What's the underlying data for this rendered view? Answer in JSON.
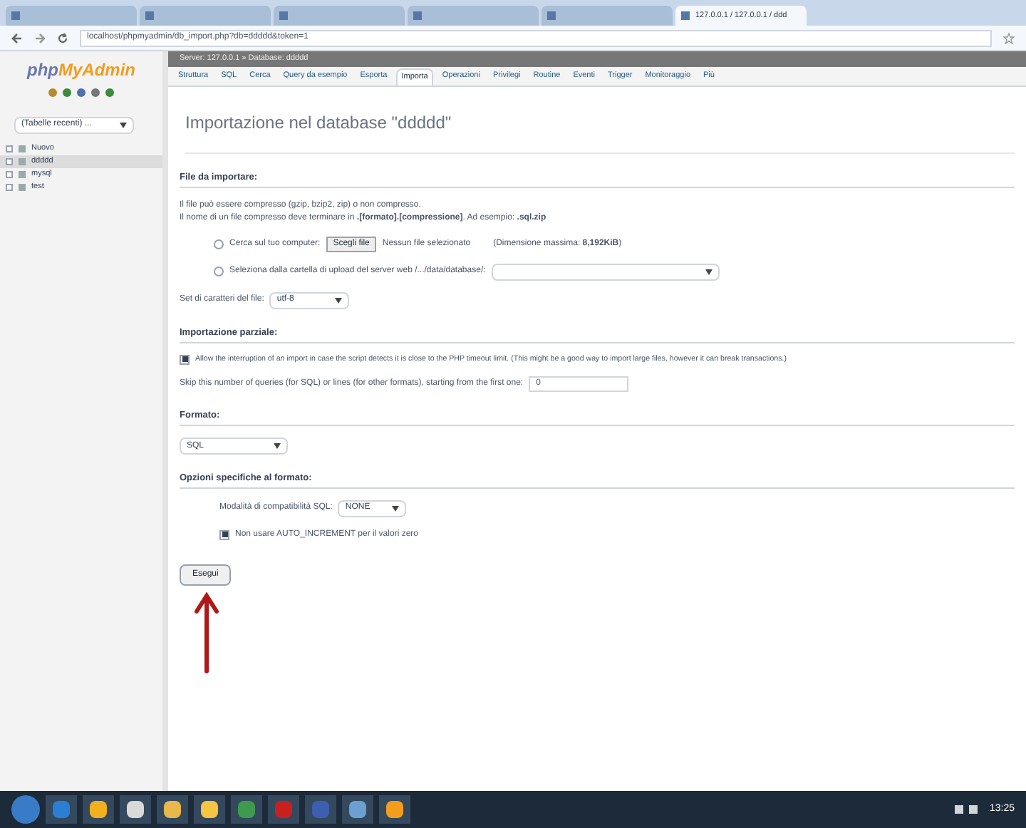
{
  "browser": {
    "tabs": [
      {
        "selected": false
      },
      {
        "selected": false
      },
      {
        "selected": false
      },
      {
        "selected": false
      },
      {
        "selected": false
      },
      {
        "title": "127.0.0.1 / 127.0.0.1 / ddd",
        "selected": true
      }
    ],
    "url": "localhost/phpmyadmin/db_import.php?db=ddddd&token=1"
  },
  "sidebar": {
    "logo_php": "php",
    "logo_name": "MyAdmin",
    "recent": "(Tabelle recenti) ...",
    "tree": [
      {
        "label": "Nuovo",
        "selected": false
      },
      {
        "label": "ddddd",
        "selected": true
      },
      {
        "label": "mysql",
        "selected": false
      },
      {
        "label": "test",
        "selected": false
      }
    ]
  },
  "breadcrumb": "Server: 127.0.0.1 » Database: ddddd",
  "tabs": [
    {
      "label": "Struttura",
      "selected": false
    },
    {
      "label": "SQL",
      "selected": false
    },
    {
      "label": "Cerca",
      "selected": false
    },
    {
      "label": "Query da esempio",
      "selected": false
    },
    {
      "label": "Esporta",
      "selected": false
    },
    {
      "label": "Importa",
      "selected": true
    },
    {
      "label": "Operazioni",
      "selected": false
    },
    {
      "label": "Privilegi",
      "selected": false
    },
    {
      "label": "Routine",
      "selected": false
    },
    {
      "label": "Eventi",
      "selected": false
    },
    {
      "label": "Trigger",
      "selected": false
    },
    {
      "label": "Monitoraggio",
      "selected": false
    },
    {
      "label": "Più",
      "selected": false
    }
  ],
  "title": "Importazione nel database \"ddddd\"",
  "file_section": {
    "heading": "File da importare:",
    "note_1": "Il file può essere compresso (gzip, bzip2, zip) o non compresso.",
    "note_2": "Il nome di un file compresso deve terminare in **.[formato].[compressione]**. Ad esempio: **.sql.zip**",
    "browse": {
      "label": "Cerca sul tuo computer:",
      "selected": false,
      "button": "Scegli file",
      "status": "Nessun file selezionato",
      "max": "(Dimensione massima: **8,192KiB**)"
    },
    "server": {
      "label": "Seleziona dalla cartella di upload del server web /.../data/database/:",
      "selected": false
    },
    "charset_label": "Set di caratteri del file:",
    "charset": "utf-8"
  },
  "partial": {
    "heading": "Importazione parziale:",
    "allow": {
      "label": "Allow the interruption of an import in case the script detects it is close to the PHP timeout limit. (This might be a good way to import large files, however it can break transactions.)",
      "checked": true
    },
    "skip_label": "Skip this number of queries (for SQL) or lines (for other formats), starting from the first one:",
    "skip_value": "0"
  },
  "format": {
    "heading": "Formato:",
    "value": "SQL"
  },
  "options": {
    "heading": "Opzioni specifiche al formato:",
    "compat_label": "Modalità di compatibilità SQL:",
    "compat_value": "NONE",
    "auto_inc": {
      "label": "Non usare AUTO_INCREMENT per il valori zero",
      "checked": true
    }
  },
  "submit": "Esegui",
  "taskbar": {
    "time": "13:25"
  }
}
